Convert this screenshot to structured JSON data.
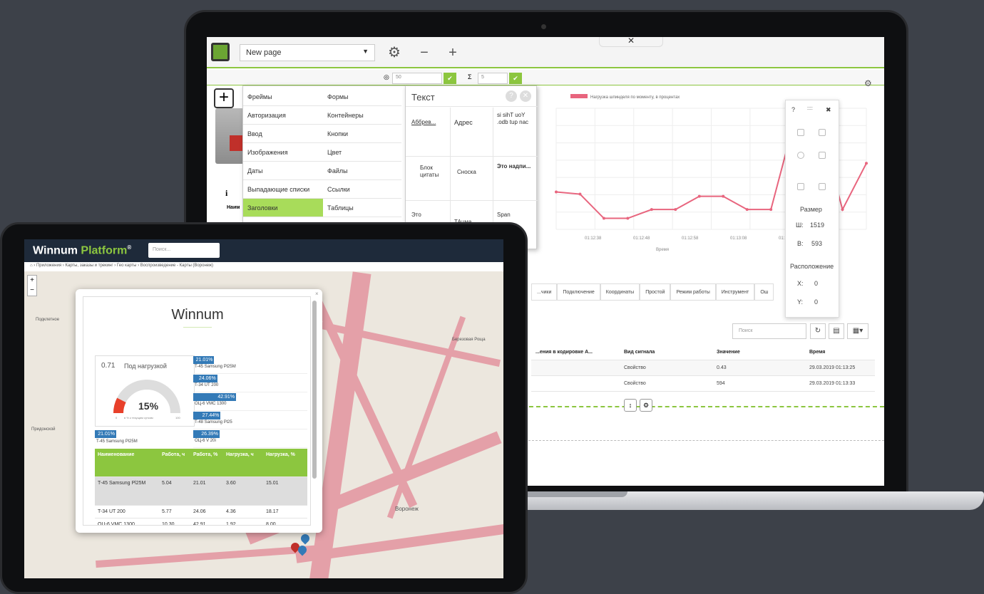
{
  "laptop": {
    "toolbar": {
      "page_select": "New page"
    },
    "subbar": {
      "input1": "50",
      "input2": "5"
    },
    "menu": {
      "col1": [
        "Фреймы",
        "Авторизация",
        "Ввод",
        "Изображения",
        "Даты",
        "Выпадающие списки",
        "Заголовки"
      ],
      "col2": [
        "Формы",
        "Контейнеры",
        "Кнопки",
        "Цвет",
        "Файлы",
        "Ссылки",
        "Таблицы"
      ],
      "active": "Заголовки"
    },
    "left_widget": {
      "naim": "Наим"
    },
    "text_panel": {
      "title": "Текст",
      "cells": [
        "Аббрев...",
        "Адрес",
        "si sihT uoY .odb tup nac",
        "Блок цитаты",
        "Сноска",
        "Это надпи...",
        "Это",
        "ТАuма",
        "Span"
      ]
    },
    "chart_legend": "Нагрузка шпинделя по моменту, в процентах",
    "float_panel": {
      "top_icons": [
        "?",
        "::::",
        "✖"
      ],
      "size_title": "Размер",
      "w_label": "Ш:",
      "w_value": "1519",
      "h_label": "В:",
      "h_value": "593",
      "pos_title": "Расположение",
      "x_label": "X:",
      "x_value": "0",
      "y_label": "Y:",
      "y_value": "0"
    },
    "tabs": [
      "...чики",
      "Подключение",
      "Координаты",
      "Простой",
      "Режим работы",
      "Инструмент",
      "Ош"
    ],
    "table": {
      "search_placeholder": "Поиск",
      "headers": [
        "...ения в кодировке А...",
        "Вид сигнала",
        "Значение",
        "Время"
      ],
      "rows": [
        [
          "",
          "Свойство",
          "0.43",
          "29.03.2019 01:13:25"
        ],
        [
          "",
          "Свойство",
          "594",
          "29.03.2019 01:13:33"
        ]
      ]
    }
  },
  "chart_data": {
    "type": "line",
    "legend": [
      "Нагрузка шпинделя по моменту, в процентах"
    ],
    "xlabel": "Время",
    "x_ticks": [
      "01:12:38",
      "01:12:48",
      "01:12:58",
      "01:13:08",
      "01:13:18",
      "01:"
    ],
    "x": [
      0,
      1,
      2,
      3,
      4,
      5,
      6,
      7,
      8,
      9,
      10,
      11,
      12,
      13
    ],
    "series": [
      {
        "name": "Нагрузка шпинделя по моменту, в процентах",
        "values": [
          34,
          32,
          10,
          10,
          18,
          18,
          30,
          30,
          18,
          18,
          100,
          100,
          18,
          60
        ]
      }
    ],
    "ylim": [
      0,
      110
    ],
    "grid": true,
    "color": "#e8657e"
  },
  "tablet": {
    "logo_main": "Winnum",
    "logo_accent": "Platform",
    "logo_reg": "®",
    "search_placeholder": "Поиск...",
    "breadcrumb": "› Приложения › Карты, заказы и трекинг › Гео карты › Воспроизведение - Карты (Воронеж)",
    "map_labels": [
      "Подклетное",
      "Воронеж",
      "Придонской",
      "Березовая Роща"
    ],
    "popup": {
      "brand": "Winnum",
      "gauge_value": "0.71",
      "gauge_label": "Под нагрузкой",
      "gauge_percent": "15%",
      "gauge_min": "0",
      "gauge_caption": "в % к текущим суткам",
      "gauge_max": "100",
      "left_bar": {
        "value": "21.01%",
        "name": "T-45 Samsung Pl25M"
      },
      "bars": [
        {
          "value": "21.01%",
          "name": "T-45 Samsung Pl25M",
          "pct": 21.01
        },
        {
          "value": "24.06%",
          "name": "T-34 UT 200",
          "pct": 24.06
        },
        {
          "value": "42.91%",
          "name": "ОЦ-6 VMC 1300",
          "pct": 42.91
        },
        {
          "value": "27.44%",
          "name": "T-48 Samsung Pl25",
          "pct": 27.44
        },
        {
          "value": "26.39%",
          "name": "ОЦ-6 V 20i",
          "pct": 26.39
        }
      ],
      "table_headers": [
        "Наименование",
        "Работа, ч",
        "Работа, %",
        "Нагрузка, ч",
        "Нагрузка, %"
      ],
      "table_rows": [
        [
          "T-45 Samsung Pl25M",
          "5.04",
          "21.01",
          "3.60",
          "15.01"
        ],
        [
          "T-34 UT 200",
          "5.77",
          "24.06",
          "4.36",
          "18.17"
        ],
        [
          "ОЦ-6 VMC 1300",
          "10.30",
          "42.91",
          "1.92",
          "8.00"
        ]
      ]
    }
  }
}
